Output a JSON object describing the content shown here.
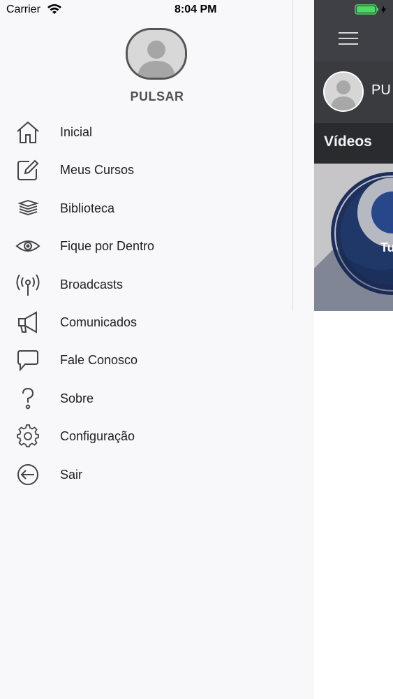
{
  "status_bar": {
    "carrier": "Carrier",
    "time": "8:04 PM"
  },
  "drawer": {
    "user_name": "PULSAR",
    "menu": [
      {
        "label": "Inicial",
        "icon": "home-icon"
      },
      {
        "label": "Meus Cursos",
        "icon": "edit-icon"
      },
      {
        "label": "Biblioteca",
        "icon": "books-icon"
      },
      {
        "label": "Fique por Dentro",
        "icon": "eye-icon"
      },
      {
        "label": "Broadcasts",
        "icon": "broadcast-icon"
      },
      {
        "label": "Comunicados",
        "icon": "megaphone-icon"
      },
      {
        "label": "Fale Conosco",
        "icon": "chat-bubble-icon"
      },
      {
        "label": "Sobre",
        "icon": "question-icon"
      },
      {
        "label": "Configuração",
        "icon": "gear-icon"
      },
      {
        "label": "Sair",
        "icon": "logout-icon"
      }
    ]
  },
  "main": {
    "profile_name": "PU",
    "section_title": "Vídeos",
    "video_caption": "Tu"
  },
  "colors": {
    "drawer_bg": "#f8f7fa",
    "header_bg": "#3f4046",
    "section_bg": "#2a2b2e",
    "battery_green": "#4cd964"
  }
}
